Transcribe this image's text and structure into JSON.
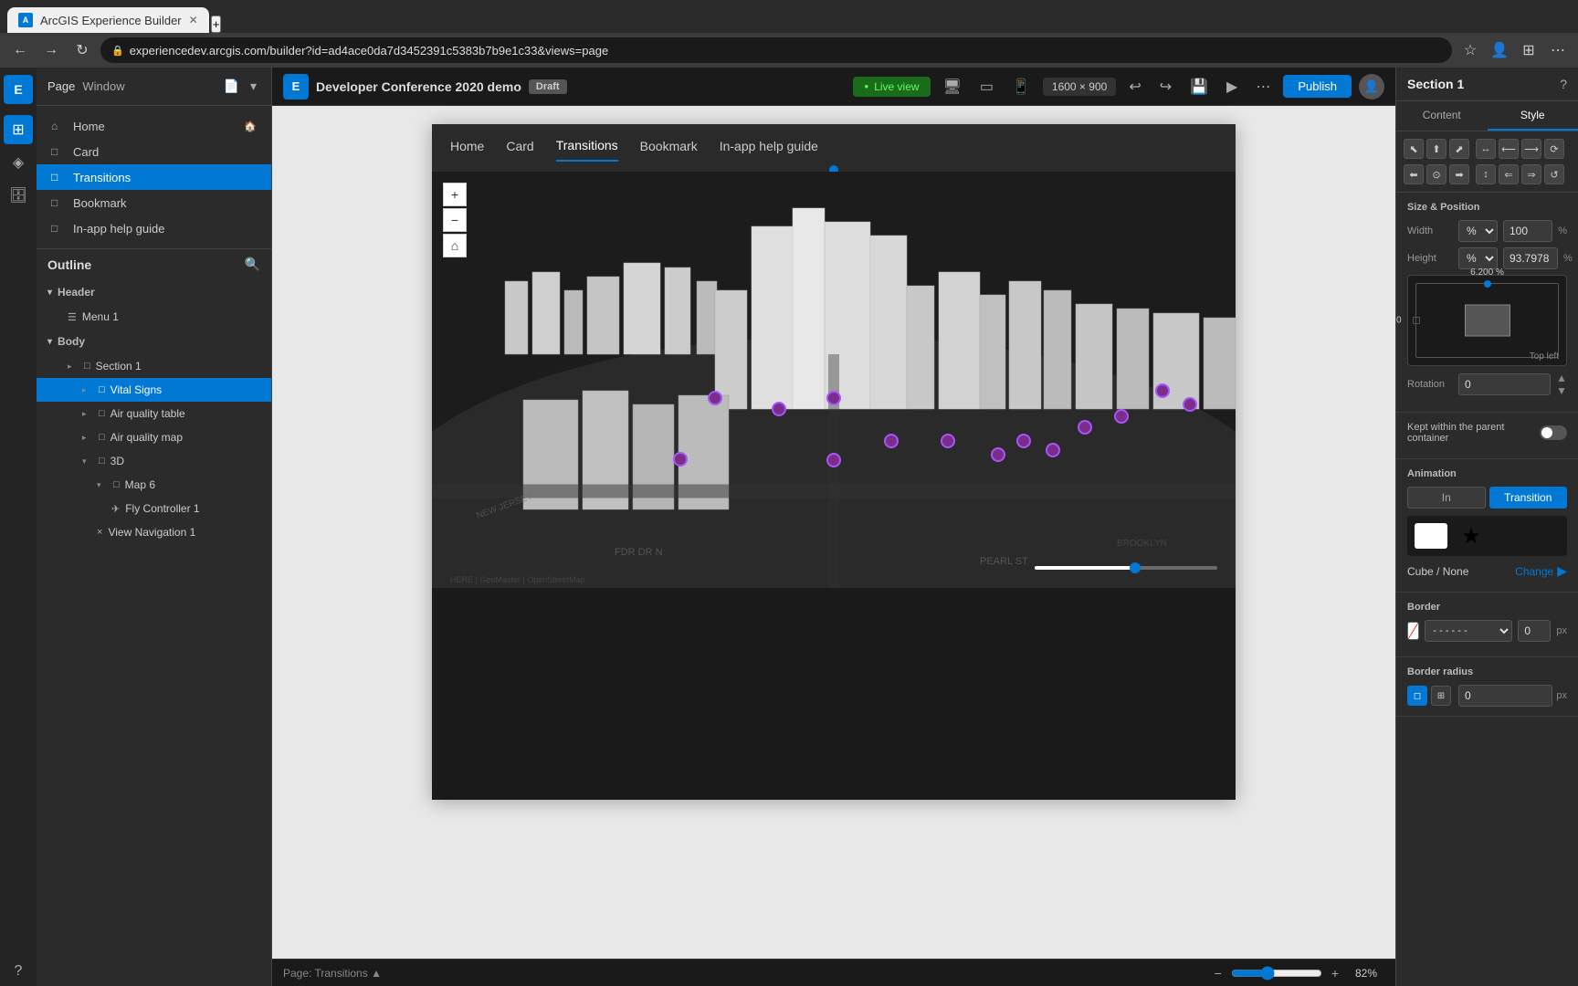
{
  "browser": {
    "tab_title": "ArcGIS Experience Builder",
    "url": "experiencedev.arcgis.com/builder?id=ad4ace0da7d3452391c5383b7b9e1c33&views=page",
    "new_tab_label": "+"
  },
  "toolbar": {
    "app_title": "Developer Conference 2020 demo",
    "draft_label": "Draft",
    "live_view_label": "Live view",
    "device_size": "1600 × 900",
    "publish_label": "Publish",
    "more_icon": "⋯"
  },
  "left_sidebar": {
    "panel_tabs": [
      "Page",
      "Window"
    ],
    "pages": [
      {
        "label": "Home",
        "icon": "🏠",
        "type": "home"
      },
      {
        "label": "Card",
        "icon": "□",
        "type": "page"
      },
      {
        "label": "Transitions",
        "icon": "□",
        "type": "page",
        "active": true
      },
      {
        "label": "Bookmark",
        "icon": "□",
        "type": "page"
      },
      {
        "label": "In-app help guide",
        "icon": "□",
        "type": "page"
      }
    ]
  },
  "outline": {
    "title": "Outline",
    "header_section": "Header",
    "items": [
      {
        "label": "Menu 1",
        "icon": "☰",
        "indent": 1,
        "type": "menu"
      },
      {
        "label": "Body",
        "indent": 0,
        "type": "group"
      },
      {
        "label": "Section 1",
        "icon": "□",
        "indent": 1,
        "type": "section",
        "expanded": true
      },
      {
        "label": "Vital Signs",
        "icon": "□",
        "indent": 2,
        "type": "widget",
        "active": true
      },
      {
        "label": "Air quality table",
        "icon": "□",
        "indent": 2,
        "type": "widget"
      },
      {
        "label": "Air quality map",
        "icon": "□",
        "indent": 2,
        "type": "widget"
      },
      {
        "label": "3D",
        "icon": "□",
        "indent": 2,
        "type": "group",
        "expanded": true
      },
      {
        "label": "Map 6",
        "icon": "□",
        "indent": 3,
        "type": "map",
        "expanded": true
      },
      {
        "label": "Fly Controller 1",
        "icon": "✈",
        "indent": 4,
        "type": "controller"
      },
      {
        "label": "View Navigation 1",
        "icon": "×",
        "indent": 3,
        "type": "widget"
      }
    ]
  },
  "preview": {
    "nav_items": [
      "Home",
      "Card",
      "Transitions",
      "Bookmark",
      "In-app help guide"
    ],
    "active_nav": "Transitions"
  },
  "right_panel": {
    "title": "Section 1",
    "tabs": [
      "Content",
      "Style"
    ],
    "active_tab": "Style",
    "alignment_section": {
      "title": "Size & Position"
    },
    "size": {
      "width_label": "Width",
      "width_value": "100",
      "width_unit": "%",
      "height_label": "Height",
      "height_value": "93.7978",
      "height_unit": "%"
    },
    "position": {
      "top_value": "6.200",
      "top_unit": "%",
      "left_value": "0",
      "left_unit": "px",
      "label": "Top left"
    },
    "rotation": {
      "label": "Rotation",
      "value": "0"
    },
    "kept_within": {
      "label": "Kept within the parent container",
      "enabled": false
    },
    "animation": {
      "title": "Animation",
      "tabs": [
        "In",
        "Transition"
      ],
      "active_tab": "Transition",
      "effect_label": "Cube / None",
      "change_label": "Change"
    },
    "border": {
      "title": "Border",
      "width_value": "0",
      "width_unit": "px"
    },
    "border_radius": {
      "title": "Border radius",
      "value": "0",
      "unit": "px"
    }
  },
  "bottom_bar": {
    "page_label": "Page:",
    "page_name": "Transitions",
    "zoom_level": "82%"
  },
  "icons": {
    "chevron_down": "▾",
    "chevron_right": "▸",
    "search": "🔍",
    "plus": "+",
    "minus": "−",
    "home_nav": "⌂",
    "back": "←",
    "forward": "→",
    "refresh": "↻",
    "lock": "🔒",
    "star": "★",
    "more": "⋯",
    "undo": "↩",
    "redo": "↪",
    "save": "💾",
    "play": "▶",
    "settings": "⚙"
  }
}
